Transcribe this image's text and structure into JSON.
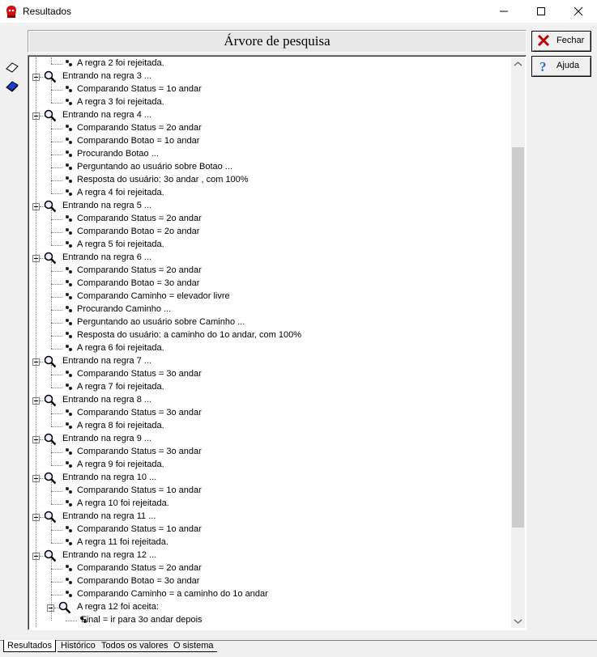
{
  "window": {
    "title": "Resultados"
  },
  "header": {
    "title": "Árvore de pesquisa"
  },
  "buttons": {
    "close_label": "Fechar",
    "help_label": "Ajuda"
  },
  "tabs": [
    "Resultados",
    "Histórico",
    "Todos os valores",
    "O sistema"
  ],
  "tree": [
    {
      "level": 2,
      "type": "leaf",
      "text": "A regra 2 foi rejeitada."
    },
    {
      "level": 1,
      "type": "node",
      "text": "Entrando na regra 3 ..."
    },
    {
      "level": 2,
      "type": "leaf",
      "text": "Comparando Status = 1o andar"
    },
    {
      "level": 2,
      "type": "leaf",
      "text": "A regra 3 foi rejeitada."
    },
    {
      "level": 1,
      "type": "node",
      "text": "Entrando na regra 4 ..."
    },
    {
      "level": 2,
      "type": "leaf",
      "text": "Comparando Status = 2o andar"
    },
    {
      "level": 2,
      "type": "leaf",
      "text": "Comparando Botao = 1o andar"
    },
    {
      "level": 2,
      "type": "leaf",
      "text": "Procurando Botao ..."
    },
    {
      "level": 2,
      "type": "leaf",
      "text": "Perguntando ao usuário sobre Botao ..."
    },
    {
      "level": 2,
      "type": "leaf",
      "text": "Resposta do usuário: 3o andar  , com 100%"
    },
    {
      "level": 2,
      "type": "leaf",
      "text": "A regra 4 foi rejeitada."
    },
    {
      "level": 1,
      "type": "node",
      "text": "Entrando na regra 5 ..."
    },
    {
      "level": 2,
      "type": "leaf",
      "text": "Comparando Status = 2o andar"
    },
    {
      "level": 2,
      "type": "leaf",
      "text": "Comparando Botao = 2o andar"
    },
    {
      "level": 2,
      "type": "leaf",
      "text": "A regra 5 foi rejeitada."
    },
    {
      "level": 1,
      "type": "node",
      "text": "Entrando na regra 6 ..."
    },
    {
      "level": 2,
      "type": "leaf",
      "text": "Comparando Status = 2o andar"
    },
    {
      "level": 2,
      "type": "leaf",
      "text": "Comparando Botao = 3o andar"
    },
    {
      "level": 2,
      "type": "leaf",
      "text": "Comparando Caminho = elevador livre"
    },
    {
      "level": 2,
      "type": "leaf",
      "text": "Procurando Caminho ..."
    },
    {
      "level": 2,
      "type": "leaf",
      "text": "Perguntando ao usuário sobre Caminho ..."
    },
    {
      "level": 2,
      "type": "leaf",
      "text": "Resposta do usuário: a caminho do 1o andar, com 100%"
    },
    {
      "level": 2,
      "type": "leaf",
      "text": "A regra 6 foi rejeitada."
    },
    {
      "level": 1,
      "type": "node",
      "text": "Entrando na regra 7 ..."
    },
    {
      "level": 2,
      "type": "leaf",
      "text": "Comparando Status = 3o andar"
    },
    {
      "level": 2,
      "type": "leaf",
      "text": "A regra 7 foi rejeitada."
    },
    {
      "level": 1,
      "type": "node",
      "text": "Entrando na regra 8 ..."
    },
    {
      "level": 2,
      "type": "leaf",
      "text": "Comparando Status = 3o andar"
    },
    {
      "level": 2,
      "type": "leaf",
      "text": "A regra 8 foi rejeitada."
    },
    {
      "level": 1,
      "type": "node",
      "text": "Entrando na regra 9 ..."
    },
    {
      "level": 2,
      "type": "leaf",
      "text": "Comparando Status = 3o andar"
    },
    {
      "level": 2,
      "type": "leaf",
      "text": "A regra 9 foi rejeitada."
    },
    {
      "level": 1,
      "type": "node",
      "text": "Entrando na regra 10 ..."
    },
    {
      "level": 2,
      "type": "leaf",
      "text": "Comparando Status = 1o andar"
    },
    {
      "level": 2,
      "type": "leaf",
      "text": "A regra 10 foi rejeitada."
    },
    {
      "level": 1,
      "type": "node",
      "text": "Entrando na regra 11 ..."
    },
    {
      "level": 2,
      "type": "leaf",
      "text": "Comparando Status = 1o andar"
    },
    {
      "level": 2,
      "type": "leaf",
      "text": "A regra 11 foi rejeitada."
    },
    {
      "level": 1,
      "type": "node",
      "text": "Entrando na regra 12 ..."
    },
    {
      "level": 2,
      "type": "leaf",
      "text": "Comparando Status = 2o andar"
    },
    {
      "level": 2,
      "type": "leaf",
      "text": "Comparando Botao = 3o andar"
    },
    {
      "level": 2,
      "type": "leaf",
      "text": "Comparando Caminho = a caminho do 1o andar"
    },
    {
      "level": 2,
      "type": "node",
      "text": "A regra 12 foi aceita:"
    },
    {
      "level": 3,
      "type": "leaf",
      "text": "Final = ir para 3o andar depois"
    }
  ],
  "icons": {
    "app": "app-icon",
    "node": "magnifier-icon",
    "leaf": "leaf-icon",
    "close": "close-x-icon",
    "help": "question-icon"
  },
  "colors": {
    "scroll_thumb": "#cdcdcd",
    "close_x": "#c00000",
    "help_q": "#1e6fd9"
  }
}
